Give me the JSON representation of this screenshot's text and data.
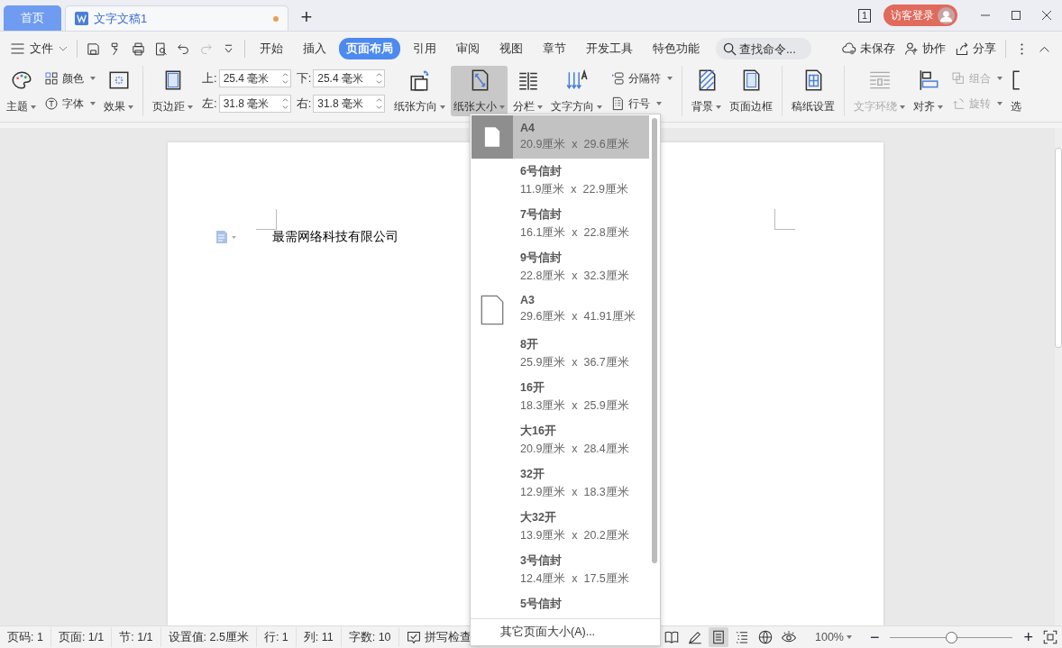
{
  "tabs": [
    {
      "label": "首页",
      "kind": "home",
      "selected": false
    },
    {
      "label": "文字文稿1",
      "kind": "doc",
      "selected": true,
      "unsaved": true
    }
  ],
  "new_tab": "+",
  "title_bar": {
    "page_count": "1",
    "login": "访客登录"
  },
  "menu": {
    "file": "文件",
    "tabs": [
      {
        "label": "开始",
        "selected": false
      },
      {
        "label": "插入",
        "selected": false
      },
      {
        "label": "页面布局",
        "selected": true
      },
      {
        "label": "引用",
        "selected": false
      },
      {
        "label": "审阅",
        "selected": false
      },
      {
        "label": "视图",
        "selected": false
      },
      {
        "label": "章节",
        "selected": false
      },
      {
        "label": "开发工具",
        "selected": false
      },
      {
        "label": "特色功能",
        "selected": false
      }
    ],
    "search": {
      "placeholder": "查找命令..."
    },
    "actions": [
      "未保存",
      "协作",
      "分享"
    ]
  },
  "ribbon": [
    {
      "kind": "large",
      "label": "主题",
      "dropdown": true,
      "disabled": false,
      "pressed": false
    },
    {
      "kind": "stack",
      "items": [
        {
          "label": "颜色",
          "dropdown": true,
          "disabled": false
        },
        {
          "label": "字体",
          "dropdown": true,
          "disabled": false
        }
      ]
    },
    {
      "kind": "large",
      "label": "效果",
      "dropdown": true,
      "disabled": false,
      "pressed": false,
      "divider_after": true
    },
    {
      "kind": "large",
      "label": "页边距",
      "dropdown": true,
      "disabled": false,
      "pressed": false
    },
    {
      "kind": "margins",
      "fields": [
        {
          "label": "上:",
          "value": "25.4 毫米"
        },
        {
          "label": "左:",
          "value": "31.8 毫米"
        },
        {
          "label": "下:",
          "value": "25.4 毫米"
        },
        {
          "label": "右:",
          "value": "31.8 毫米"
        }
      ]
    },
    {
      "kind": "large",
      "label": "纸张方向",
      "dropdown": true,
      "disabled": false,
      "pressed": false
    },
    {
      "kind": "large",
      "label": "纸张大小",
      "dropdown": true,
      "disabled": false,
      "pressed": true
    },
    {
      "kind": "large",
      "label": "分栏",
      "dropdown": true,
      "disabled": false,
      "pressed": false
    },
    {
      "kind": "large",
      "label": "文字方向",
      "dropdown": true,
      "disabled": false,
      "pressed": false
    },
    {
      "kind": "stack",
      "items": [
        {
          "label": "分隔符",
          "dropdown": true,
          "disabled": false
        },
        {
          "label": "行号",
          "dropdown": true,
          "disabled": false
        }
      ],
      "divider_after": true
    },
    {
      "kind": "large",
      "label": "背景",
      "dropdown": true,
      "disabled": false,
      "pressed": false
    },
    {
      "kind": "large",
      "label": "页面边框",
      "dropdown": false,
      "disabled": false,
      "pressed": false,
      "divider_after": true
    },
    {
      "kind": "large",
      "label": "稿纸设置",
      "dropdown": false,
      "disabled": false,
      "pressed": false,
      "divider_after": true
    },
    {
      "kind": "large",
      "label": "文字环绕",
      "dropdown": true,
      "disabled": true,
      "pressed": false
    },
    {
      "kind": "large",
      "label": "对齐",
      "dropdown": true,
      "disabled": false,
      "pressed": false
    },
    {
      "kind": "stack",
      "items": [
        {
          "label": "组合",
          "dropdown": true,
          "disabled": true
        },
        {
          "label": "旋转",
          "dropdown": true,
          "disabled": true
        }
      ]
    },
    {
      "kind": "large",
      "label": "选",
      "dropdown": false,
      "disabled": false,
      "pressed": false
    }
  ],
  "document": {
    "text": "最需网络科技有限公司"
  },
  "paper_menu": {
    "items": [
      {
        "name": "A4",
        "size": "20.9厘米  x  29.6厘米",
        "kind": "page",
        "selected": true
      },
      {
        "name": "6号信封",
        "size": "11.9厘米  x  22.9厘米",
        "kind": "plain",
        "selected": false
      },
      {
        "name": "7号信封",
        "size": "16.1厘米  x  22.8厘米",
        "kind": "plain",
        "selected": false
      },
      {
        "name": "9号信封",
        "size": "22.8厘米  x  32.3厘米",
        "kind": "plain",
        "selected": false
      },
      {
        "name": "A3",
        "size": "29.6厘米  x  41.91厘米",
        "kind": "page",
        "selected": false
      },
      {
        "name": "8开",
        "size": "25.9厘米  x  36.7厘米",
        "kind": "plain",
        "selected": false
      },
      {
        "name": "16开",
        "size": "18.3厘米  x  25.9厘米",
        "kind": "plain",
        "selected": false
      },
      {
        "name": "大16开",
        "size": "20.9厘米  x  28.4厘米",
        "kind": "plain",
        "selected": false
      },
      {
        "name": "32开",
        "size": "12.9厘米  x  18.3厘米",
        "kind": "plain",
        "selected": false
      },
      {
        "name": "大32开",
        "size": "13.9厘米  x  20.2厘米",
        "kind": "plain",
        "selected": false
      },
      {
        "name": "3号信封",
        "size": "12.4厘米  x  17.5厘米",
        "kind": "plain",
        "selected": false
      },
      {
        "name": "5号信封",
        "kind": "plain",
        "selected": false
      }
    ],
    "footer": "其它页面大小(A)..."
  },
  "status_bar": {
    "items": [
      "页码: 1",
      "页面: 1/1",
      "节: 1/1",
      "设置值: 2.5厘米",
      "行: 1",
      "列: 11",
      "字数: 10"
    ],
    "spell_check": "拼写检查",
    "views": [
      {
        "selected": false
      },
      {
        "selected": false
      },
      {
        "selected": true
      },
      {
        "selected": false
      },
      {
        "selected": false
      },
      {
        "selected": false
      }
    ],
    "zoom": "100%",
    "zoom_slider": {
      "level": 0.5
    },
    "zoom_out": "−",
    "zoom_in": "+"
  }
}
